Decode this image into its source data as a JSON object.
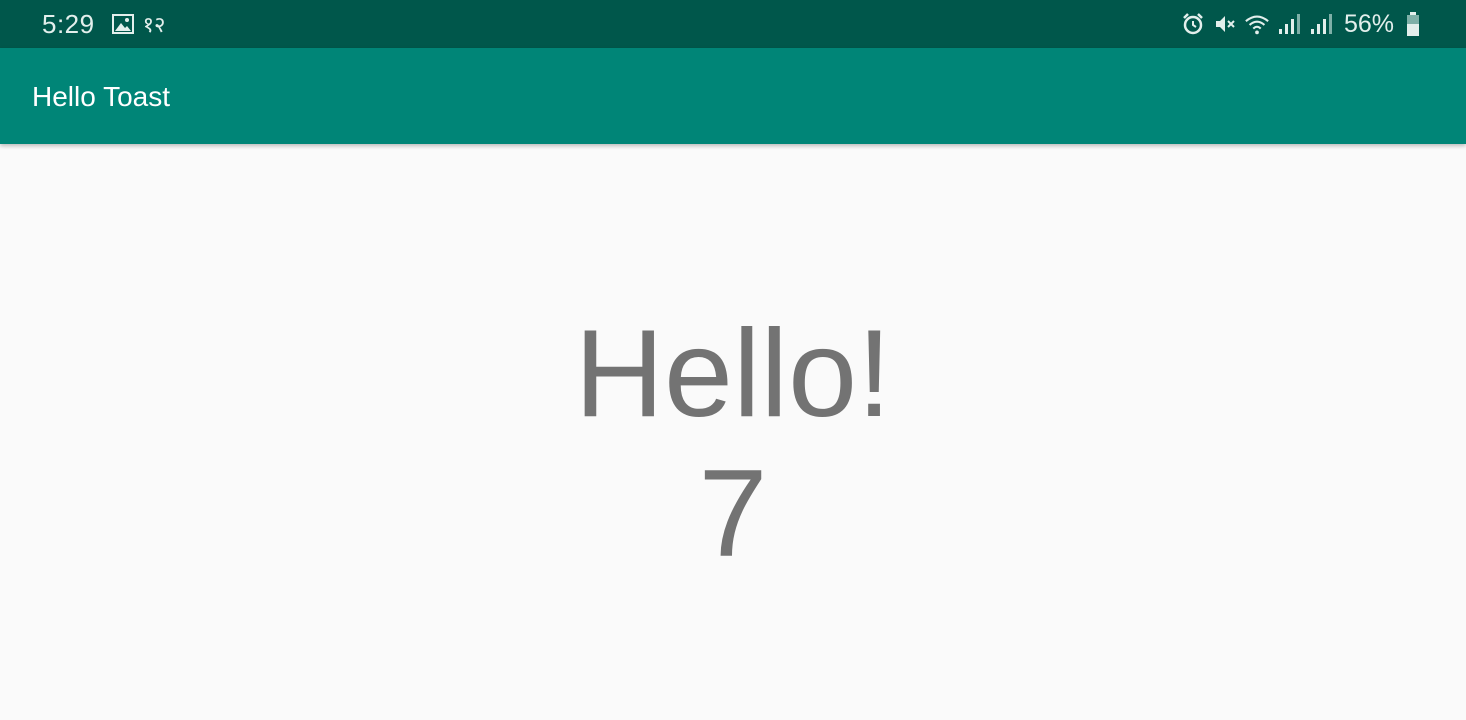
{
  "status_bar": {
    "time": "5:29",
    "extra_text": "१२",
    "battery_percent": "56%",
    "icons": [
      "image-icon",
      "alarm-icon",
      "mute-icon",
      "wifi-icon",
      "signal-icon",
      "signal-icon",
      "battery-icon"
    ]
  },
  "app_bar": {
    "title": "Hello Toast",
    "color": "#008577"
  },
  "main": {
    "hello_text": "Hello!",
    "count": "7"
  }
}
